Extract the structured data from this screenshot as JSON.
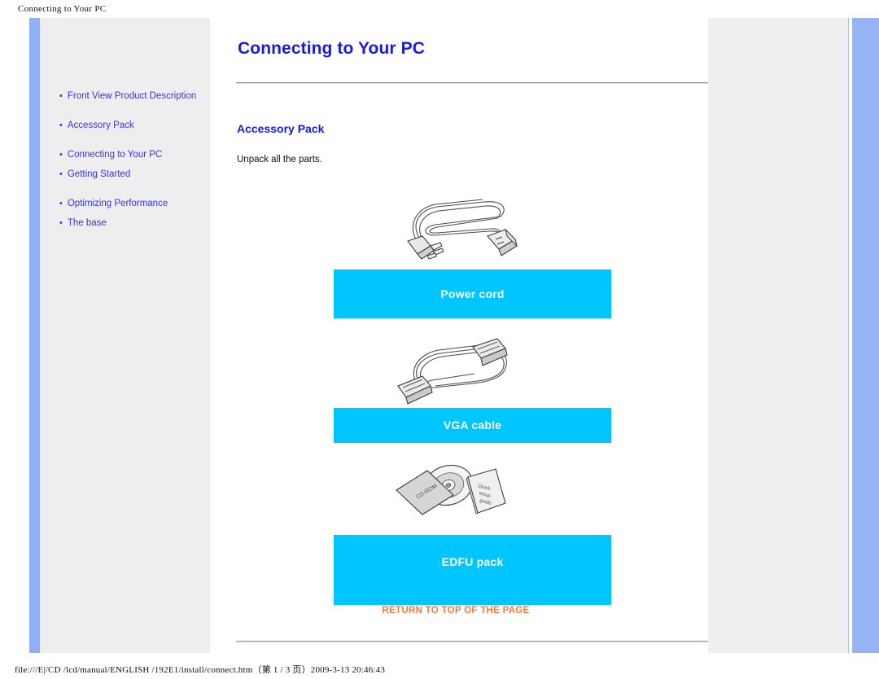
{
  "print": {
    "header_title": "Connecting to Your PC",
    "footer_text": "file:///E|/CD /lcd/manual/ENGLISH /192E1/install/connect.htm（第 1 / 3 页）2009-3-13 20:46:43"
  },
  "sidebar": {
    "items": [
      {
        "label": "Front View Product Description",
        "bullet": "•"
      },
      {
        "label": "Accessory Pack",
        "bullet": "•"
      },
      {
        "label": "Connecting to Your PC",
        "bullet": "•"
      },
      {
        "label": "Getting Started",
        "bullet": "•"
      },
      {
        "label": "Optimizing Performance",
        "bullet": "•"
      },
      {
        "label": "The base",
        "bullet": "•"
      }
    ]
  },
  "content": {
    "page_title": "Connecting to Your PC",
    "section_title": "Accessory Pack",
    "body_text": "Unpack all the parts.",
    "return_link": "RETURN TO TOP OF THE PAGE",
    "accessories": [
      {
        "name": "power-cord",
        "label": "Power cord",
        "icon": "power-cord-illustration"
      },
      {
        "name": "vga-cable",
        "label": "VGA cable",
        "icon": "vga-cable-illustration"
      },
      {
        "name": "edfu-pack",
        "label": "EDFU pack",
        "icon": "edfu-pack-illustration"
      }
    ],
    "illustration_labels": {
      "cd_rom": "CD-ROM",
      "quick_setup_guide": "Quick setup guide"
    }
  },
  "colors": {
    "accent_blue": "#1a1ae0",
    "bar_cyan": "#00c6ff",
    "link_orange": "#ff7733",
    "nav_blue": "#8fb0f6",
    "panel_gray": "#eeeeee"
  }
}
